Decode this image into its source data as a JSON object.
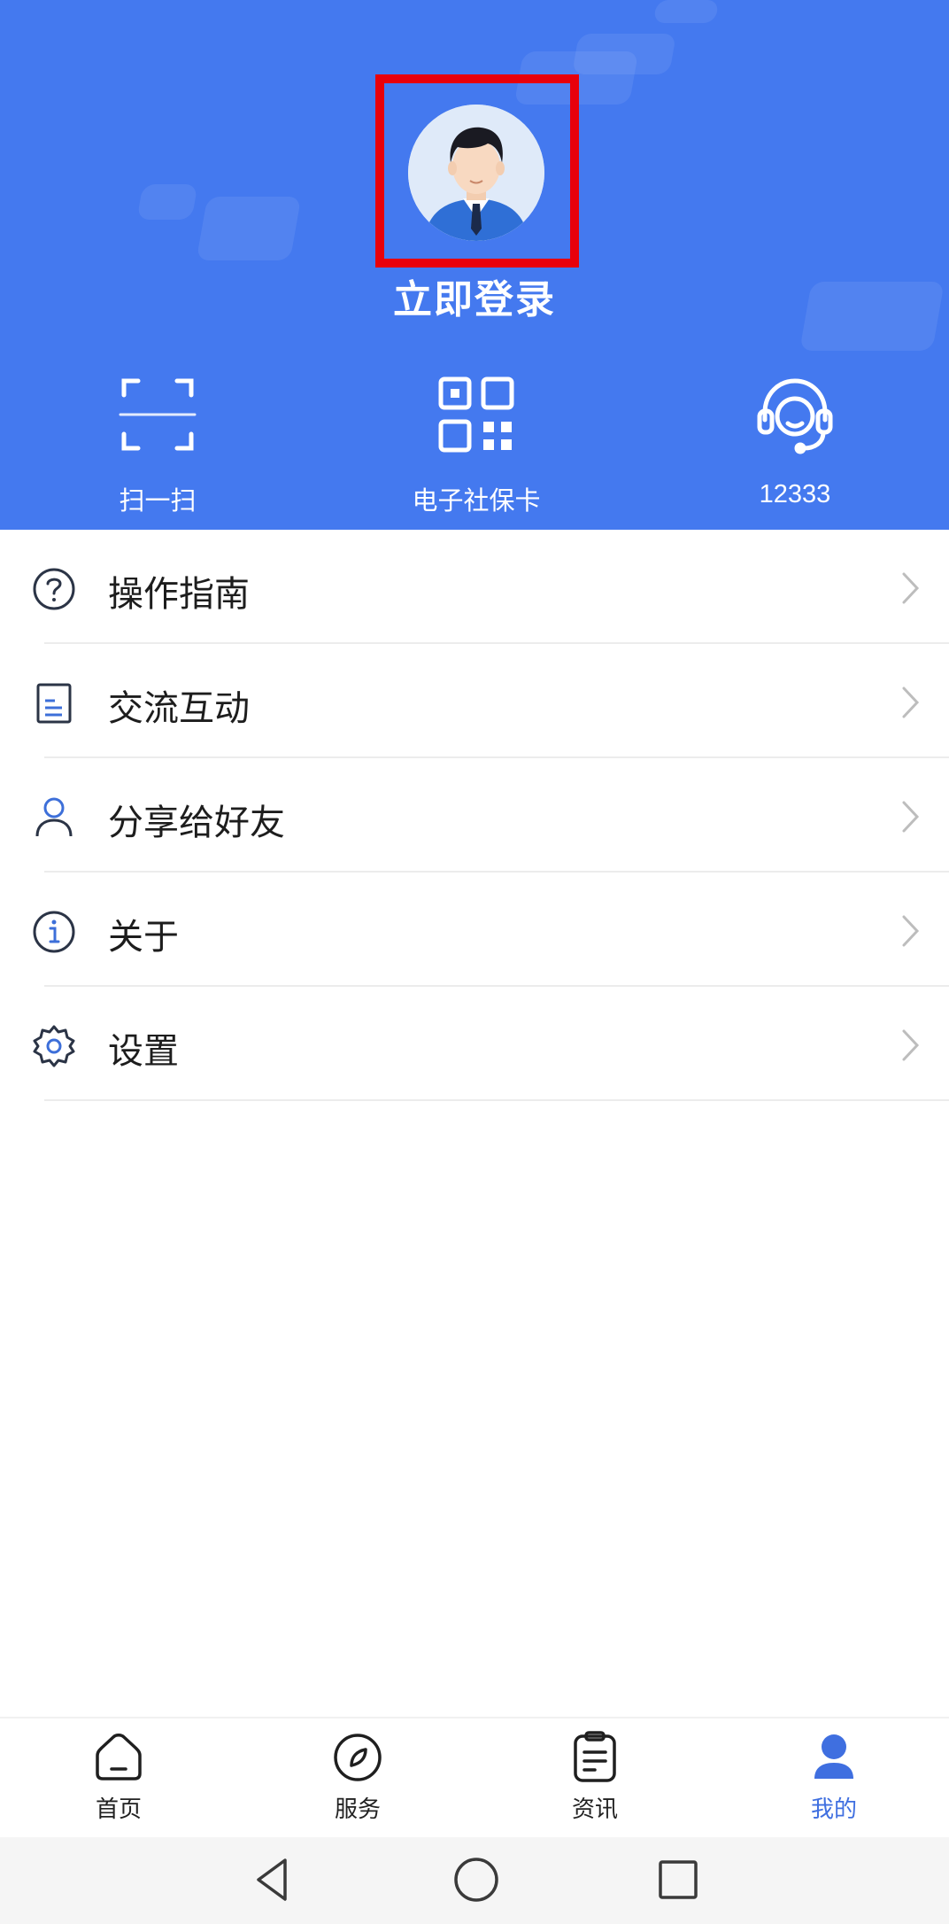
{
  "colors": {
    "header_bg": "#4479ef",
    "highlight_frame": "#e8000b",
    "active_tab": "#3f6fe0",
    "text": "#1d1d1d"
  },
  "header": {
    "login_text": "立即登录",
    "avatar_icon": "user-avatar-illustration",
    "quick_actions": [
      {
        "label": "扫一扫",
        "icon": "scan-icon"
      },
      {
        "label": "电子社保卡",
        "icon": "qr-code-icon"
      },
      {
        "label": "12333",
        "icon": "headset-icon"
      }
    ]
  },
  "menu": {
    "items": [
      {
        "label": "操作指南",
        "icon": "help-circle-icon"
      },
      {
        "label": "交流互动",
        "icon": "document-icon"
      },
      {
        "label": "分享给好友",
        "icon": "person-icon"
      },
      {
        "label": "关于",
        "icon": "info-icon"
      },
      {
        "label": "设置",
        "icon": "gear-icon"
      }
    ]
  },
  "tabbar": {
    "tabs": [
      {
        "label": "首页",
        "icon": "home-icon",
        "active": false
      },
      {
        "label": "服务",
        "icon": "compass-icon",
        "active": false
      },
      {
        "label": "资讯",
        "icon": "news-icon",
        "active": false
      },
      {
        "label": "我的",
        "icon": "profile-icon",
        "active": true
      }
    ]
  },
  "system_nav": {
    "buttons": [
      "back-icon",
      "home-circle-icon",
      "recent-apps-icon"
    ]
  }
}
